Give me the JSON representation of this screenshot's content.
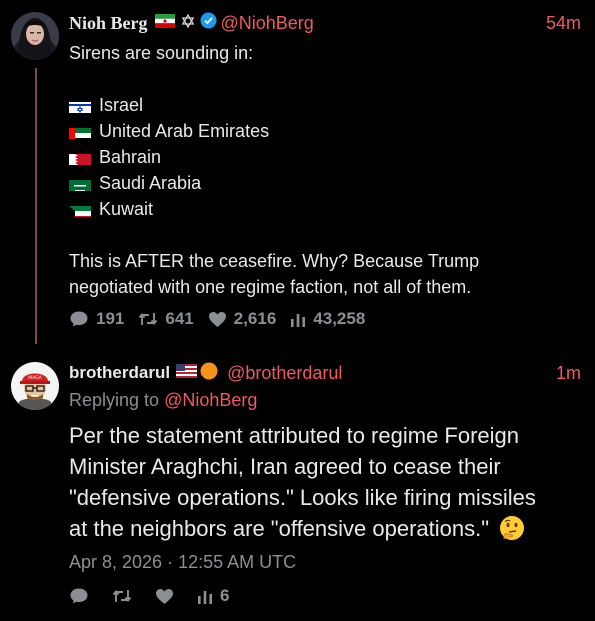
{
  "tweet1": {
    "author_name": "Nioh Berg",
    "handle": "@NiohBerg",
    "time": "54m",
    "intro": "Sirens are sounding in:",
    "countries": [
      {
        "flag": "israel-flag",
        "label": "Israel"
      },
      {
        "flag": "uae-flag",
        "label": "United Arab Emirates"
      },
      {
        "flag": "bahrain-flag",
        "label": "Bahrain"
      },
      {
        "flag": "saudi-flag",
        "label": "Saudi Arabia"
      },
      {
        "flag": "kuwait-flag",
        "label": "Kuwait"
      }
    ],
    "closing_line1": "This is AFTER the ceasefire. Why? Because Trump",
    "closing_line2": "negotiated with one regime faction, not all of them.",
    "stats": {
      "replies": "191",
      "reposts": "641",
      "likes": "2,616",
      "views": "43,258"
    }
  },
  "tweet2": {
    "author_name": "brotherdarul",
    "handle": "@brotherdarul",
    "time": "1m",
    "replying_prefix": "Replying to ",
    "replying_handle": "@NiohBerg",
    "line1": "Per the statement attributed to regime Foreign",
    "line2": "Minister Araghchi, Iran agreed to cease their",
    "line3": "\"defensive operations.\"  Looks like firing missiles",
    "line4": "at the neighbors are \"offensive operations.\"",
    "emoji": "thinking-face",
    "date": "Apr 8, 2026 · 12:55 AM UTC",
    "stats": {
      "views": "6"
    }
  },
  "colors": {
    "accent": "#f0595f",
    "muted": "#8b8f93",
    "thread": "#7a4a4a",
    "verified": "#1d9bf0"
  }
}
